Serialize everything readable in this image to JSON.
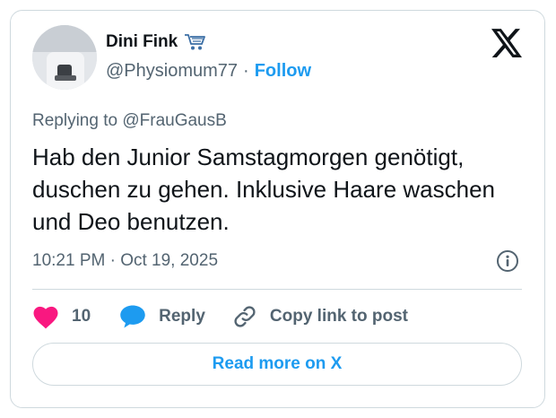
{
  "author": {
    "name": "Dini Fink",
    "badge_icon": "shopping-cart-icon",
    "handle": "@Physiomum77",
    "separator": "·",
    "follow_label": "Follow",
    "avatar_icon": "profile-photo"
  },
  "brand": {
    "logo_icon": "x-logo-icon"
  },
  "reply_context": {
    "prefix": "Replying to",
    "mention": "@FrauGausB"
  },
  "tweet": {
    "text": "Hab den Junior Samstagmorgen genötigt, duschen zu gehen. Inklusive Haare waschen und Deo benutzen.",
    "timestamp": "10:21 PM · Oct 19, 2025",
    "info_icon": "info-icon"
  },
  "actions": {
    "like_count": "10",
    "reply_label": "Reply",
    "copy_label": "Copy link to post"
  },
  "footer": {
    "read_more_label": "Read more on X"
  },
  "colors": {
    "accent": "#1d9bf0",
    "like": "#f91880",
    "text": "#0f1419",
    "secondary": "#536471",
    "border": "#cfd9de"
  }
}
